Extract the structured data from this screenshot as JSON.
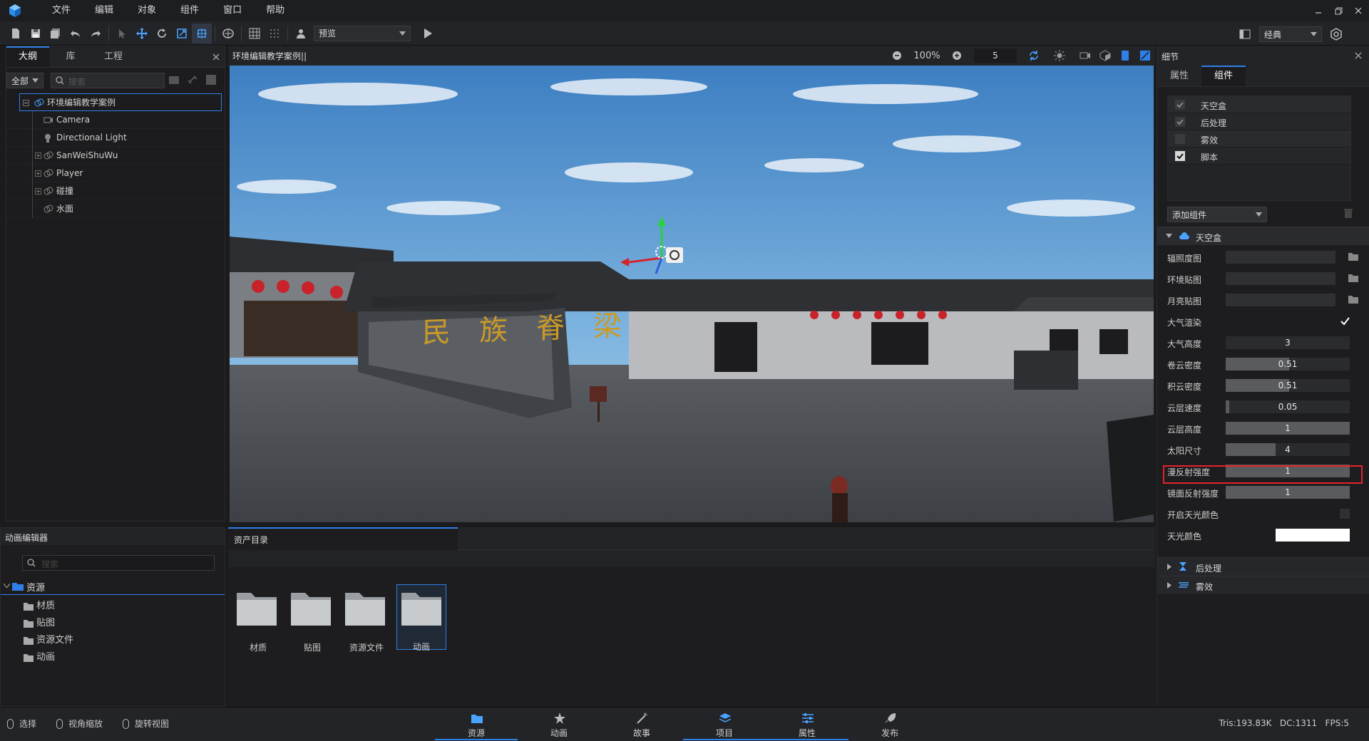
{
  "menu": {
    "items": [
      "文件",
      "编辑",
      "对象",
      "组件",
      "窗口",
      "帮助"
    ]
  },
  "toolbar": {
    "preview_label": "预览",
    "layout_label": "经典"
  },
  "outline": {
    "tabs": [
      "大纲",
      "库",
      "工程"
    ],
    "filter_label": "全部",
    "search_placeholder": "搜索",
    "items": [
      {
        "label": "环境编辑教学案例",
        "icon": "group-icon"
      },
      {
        "label": "Camera",
        "icon": "camera-icon"
      },
      {
        "label": "Directional Light",
        "icon": "light-icon"
      },
      {
        "label": "SanWeiShuWu",
        "icon": "group-icon"
      },
      {
        "label": "Player",
        "icon": "group-icon"
      },
      {
        "label": "碰撞",
        "icon": "group-icon"
      },
      {
        "label": "水面",
        "icon": "group-icon"
      }
    ]
  },
  "viewport": {
    "title": "环境编辑教学案例||",
    "zoom": "100%",
    "speed": "5",
    "sign_text": "民族脊梁"
  },
  "details": {
    "title": "细节",
    "tabs": [
      "属性",
      "组件"
    ],
    "components": [
      {
        "label": "天空盒",
        "checked": true,
        "dim": true
      },
      {
        "label": "后处理",
        "checked": true,
        "dim": true
      },
      {
        "label": "雾效",
        "checked": false,
        "dim": true
      },
      {
        "label": "脚本",
        "checked": true,
        "dim": false
      }
    ],
    "add_component": "添加组件",
    "skybox_section": "天空盒",
    "properties": [
      {
        "label": "辐照度图",
        "type": "texture"
      },
      {
        "label": "环境贴图",
        "type": "texture"
      },
      {
        "label": "月亮贴图",
        "type": "texture"
      },
      {
        "label": "大气渲染",
        "type": "check",
        "checked": true
      },
      {
        "label": "大气高度",
        "type": "slider",
        "value": "3",
        "fraction": 0
      },
      {
        "label": "卷云密度",
        "type": "slider",
        "value": "0.51",
        "fraction": 0.51
      },
      {
        "label": "积云密度",
        "type": "slider",
        "value": "0.51",
        "fraction": 0.51
      },
      {
        "label": "云层速度",
        "type": "slider",
        "value": "0.05",
        "fraction": 0.03
      },
      {
        "label": "云层高度",
        "type": "slider",
        "value": "1",
        "fraction": 1
      },
      {
        "label": "太阳尺寸",
        "type": "slider",
        "value": "4",
        "fraction": 0.4
      },
      {
        "label": "漫反射强度",
        "type": "slider",
        "value": "1",
        "fraction": 1
      },
      {
        "label": "镜面反射强度",
        "type": "slider",
        "value": "1",
        "fraction": 1
      },
      {
        "label": "开启天光颜色",
        "type": "check",
        "checked": false
      },
      {
        "label": "天光颜色",
        "type": "color",
        "color": "#ffffff"
      }
    ],
    "collapsed_sections": [
      "后处理",
      "雾效"
    ]
  },
  "anim_editor": {
    "title": "动画编辑器",
    "search_placeholder": "搜索",
    "root": "资源",
    "children": [
      "材质",
      "贴图",
      "资源文件",
      "动画"
    ]
  },
  "assets": {
    "tab": "资产目录",
    "folders": [
      "材质",
      "贴图",
      "资源文件",
      "动画"
    ],
    "selected": "动画"
  },
  "statusbar": {
    "tools": [
      "选择",
      "视角缩放",
      "旋转视图"
    ],
    "nav": [
      "资源",
      "动画",
      "故事",
      "项目",
      "属性",
      "发布"
    ],
    "stats": "Tris:193.83K   DC:1311   FPS:5"
  },
  "colors": {
    "accent": "#2f7fe8",
    "highlight": "#e0252a",
    "sky_top": "#3f82c6"
  }
}
